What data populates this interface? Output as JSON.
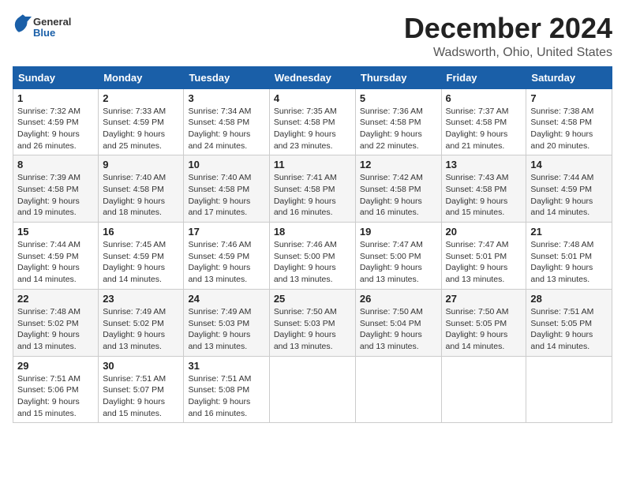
{
  "header": {
    "logo_general": "General",
    "logo_blue": "Blue",
    "month_title": "December 2024",
    "location": "Wadsworth, Ohio, United States"
  },
  "days_of_week": [
    "Sunday",
    "Monday",
    "Tuesday",
    "Wednesday",
    "Thursday",
    "Friday",
    "Saturday"
  ],
  "weeks": [
    [
      {
        "day": "1",
        "sunrise": "7:32 AM",
        "sunset": "4:59 PM",
        "daylight": "9 hours and 26 minutes."
      },
      {
        "day": "2",
        "sunrise": "7:33 AM",
        "sunset": "4:59 PM",
        "daylight": "9 hours and 25 minutes."
      },
      {
        "day": "3",
        "sunrise": "7:34 AM",
        "sunset": "4:58 PM",
        "daylight": "9 hours and 24 minutes."
      },
      {
        "day": "4",
        "sunrise": "7:35 AM",
        "sunset": "4:58 PM",
        "daylight": "9 hours and 23 minutes."
      },
      {
        "day": "5",
        "sunrise": "7:36 AM",
        "sunset": "4:58 PM",
        "daylight": "9 hours and 22 minutes."
      },
      {
        "day": "6",
        "sunrise": "7:37 AM",
        "sunset": "4:58 PM",
        "daylight": "9 hours and 21 minutes."
      },
      {
        "day": "7",
        "sunrise": "7:38 AM",
        "sunset": "4:58 PM",
        "daylight": "9 hours and 20 minutes."
      }
    ],
    [
      {
        "day": "8",
        "sunrise": "7:39 AM",
        "sunset": "4:58 PM",
        "daylight": "9 hours and 19 minutes."
      },
      {
        "day": "9",
        "sunrise": "7:40 AM",
        "sunset": "4:58 PM",
        "daylight": "9 hours and 18 minutes."
      },
      {
        "day": "10",
        "sunrise": "7:40 AM",
        "sunset": "4:58 PM",
        "daylight": "9 hours and 17 minutes."
      },
      {
        "day": "11",
        "sunrise": "7:41 AM",
        "sunset": "4:58 PM",
        "daylight": "9 hours and 16 minutes."
      },
      {
        "day": "12",
        "sunrise": "7:42 AM",
        "sunset": "4:58 PM",
        "daylight": "9 hours and 16 minutes."
      },
      {
        "day": "13",
        "sunrise": "7:43 AM",
        "sunset": "4:58 PM",
        "daylight": "9 hours and 15 minutes."
      },
      {
        "day": "14",
        "sunrise": "7:44 AM",
        "sunset": "4:59 PM",
        "daylight": "9 hours and 14 minutes."
      }
    ],
    [
      {
        "day": "15",
        "sunrise": "7:44 AM",
        "sunset": "4:59 PM",
        "daylight": "9 hours and 14 minutes."
      },
      {
        "day": "16",
        "sunrise": "7:45 AM",
        "sunset": "4:59 PM",
        "daylight": "9 hours and 14 minutes."
      },
      {
        "day": "17",
        "sunrise": "7:46 AM",
        "sunset": "4:59 PM",
        "daylight": "9 hours and 13 minutes."
      },
      {
        "day": "18",
        "sunrise": "7:46 AM",
        "sunset": "5:00 PM",
        "daylight": "9 hours and 13 minutes."
      },
      {
        "day": "19",
        "sunrise": "7:47 AM",
        "sunset": "5:00 PM",
        "daylight": "9 hours and 13 minutes."
      },
      {
        "day": "20",
        "sunrise": "7:47 AM",
        "sunset": "5:01 PM",
        "daylight": "9 hours and 13 minutes."
      },
      {
        "day": "21",
        "sunrise": "7:48 AM",
        "sunset": "5:01 PM",
        "daylight": "9 hours and 13 minutes."
      }
    ],
    [
      {
        "day": "22",
        "sunrise": "7:48 AM",
        "sunset": "5:02 PM",
        "daylight": "9 hours and 13 minutes."
      },
      {
        "day": "23",
        "sunrise": "7:49 AM",
        "sunset": "5:02 PM",
        "daylight": "9 hours and 13 minutes."
      },
      {
        "day": "24",
        "sunrise": "7:49 AM",
        "sunset": "5:03 PM",
        "daylight": "9 hours and 13 minutes."
      },
      {
        "day": "25",
        "sunrise": "7:50 AM",
        "sunset": "5:03 PM",
        "daylight": "9 hours and 13 minutes."
      },
      {
        "day": "26",
        "sunrise": "7:50 AM",
        "sunset": "5:04 PM",
        "daylight": "9 hours and 13 minutes."
      },
      {
        "day": "27",
        "sunrise": "7:50 AM",
        "sunset": "5:05 PM",
        "daylight": "9 hours and 14 minutes."
      },
      {
        "day": "28",
        "sunrise": "7:51 AM",
        "sunset": "5:05 PM",
        "daylight": "9 hours and 14 minutes."
      }
    ],
    [
      {
        "day": "29",
        "sunrise": "7:51 AM",
        "sunset": "5:06 PM",
        "daylight": "9 hours and 15 minutes."
      },
      {
        "day": "30",
        "sunrise": "7:51 AM",
        "sunset": "5:07 PM",
        "daylight": "9 hours and 15 minutes."
      },
      {
        "day": "31",
        "sunrise": "7:51 AM",
        "sunset": "5:08 PM",
        "daylight": "9 hours and 16 minutes."
      },
      null,
      null,
      null,
      null
    ]
  ]
}
